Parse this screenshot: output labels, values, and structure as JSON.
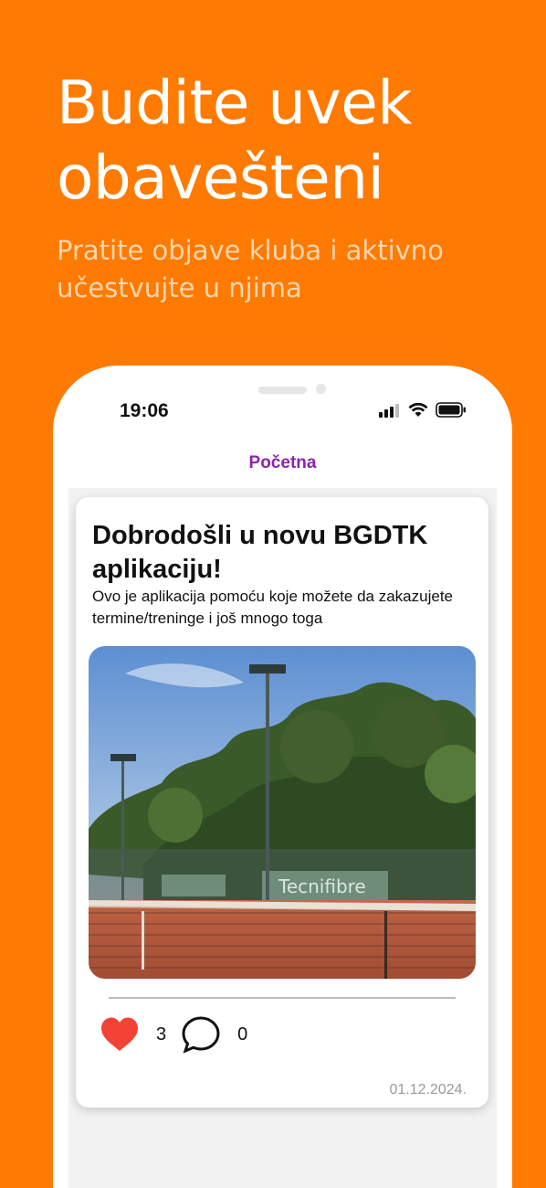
{
  "promo": {
    "headline_line1": "Budite uvek",
    "headline_line2": "obavešteni",
    "subline_line1": "Pratite objave kluba i aktivno",
    "subline_line2": "učestvujte u njima"
  },
  "status_bar": {
    "time": "19:06",
    "icons": [
      "signal-icon",
      "wifi-icon",
      "battery-icon"
    ]
  },
  "nav": {
    "title": "Početna"
  },
  "post": {
    "title": "Dobrodošli u novu BGDTK aplikaciju!",
    "body": "Ovo je aplikacija pomoću koje možete da zakazujete termine/treninge i još mnogo toga",
    "image_banner_text": "Tecnifibre",
    "likes": "3",
    "comments": "0",
    "date": "01.12.2024."
  },
  "colors": {
    "background": "#FF7A00",
    "accent": "#8E24AA",
    "like": "#F44336"
  }
}
